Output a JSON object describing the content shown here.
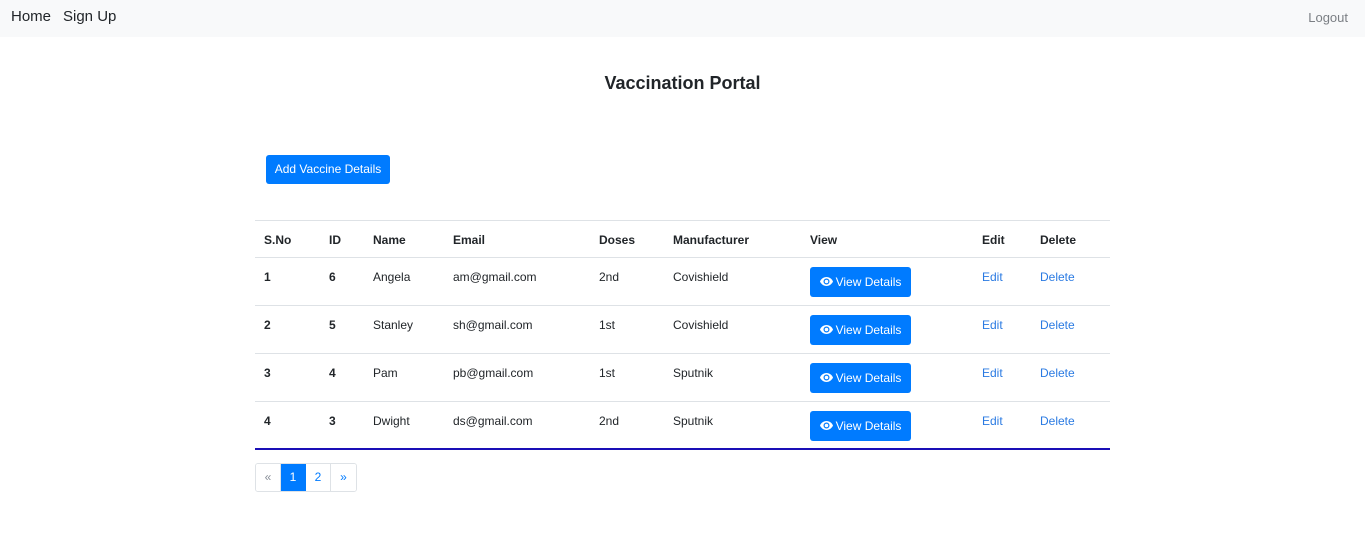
{
  "nav": {
    "home": "Home",
    "signup": "Sign Up",
    "logout": "Logout"
  },
  "title": "Vaccination Portal",
  "add_button": "Add Vaccine Details",
  "table": {
    "headers": [
      "S.No",
      "ID",
      "Name",
      "Email",
      "Doses",
      "Manufacturer",
      "View",
      "Edit",
      "Delete"
    ],
    "rows": [
      {
        "sno": "1",
        "id": "6",
        "name": "Angela",
        "email": "am@gmail.com",
        "doses": "2nd",
        "manufacturer": "Covishield",
        "view": "View Details",
        "edit": "Edit",
        "delete": "Delete"
      },
      {
        "sno": "2",
        "id": "5",
        "name": "Stanley",
        "email": "sh@gmail.com",
        "doses": "1st",
        "manufacturer": "Covishield",
        "view": "View Details",
        "edit": "Edit",
        "delete": "Delete"
      },
      {
        "sno": "3",
        "id": "4",
        "name": "Pam",
        "email": "pb@gmail.com",
        "doses": "1st",
        "manufacturer": "Sputnik",
        "view": "View Details",
        "edit": "Edit",
        "delete": "Delete"
      },
      {
        "sno": "4",
        "id": "3",
        "name": "Dwight",
        "email": "ds@gmail.com",
        "doses": "2nd",
        "manufacturer": "Sputnik",
        "view": "View Details",
        "edit": "Edit",
        "delete": "Delete"
      }
    ]
  },
  "pagination": {
    "prev": "«",
    "pages": [
      "1",
      "2"
    ],
    "active_page": "1",
    "next": "»"
  },
  "colors": {
    "primary": "#007bff",
    "link": "#2a7ae2",
    "navbar_bg": "#f8f9fa",
    "table_bottom_border": "#1a0fb6"
  },
  "icons": {
    "view_button": "eye-icon"
  }
}
